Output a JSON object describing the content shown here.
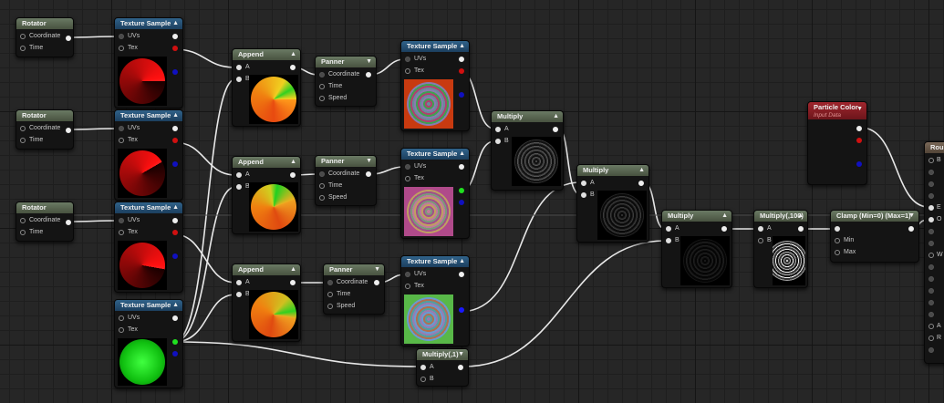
{
  "nodes": {
    "rotator1": {
      "title": "Rotator",
      "pins": [
        "Coordinate",
        "Time"
      ]
    },
    "rotator2": {
      "title": "Rotator",
      "pins": [
        "Coordinate",
        "Time"
      ]
    },
    "rotator3": {
      "title": "Rotator",
      "pins": [
        "Coordinate",
        "Time"
      ]
    },
    "texsample1": {
      "title": "Texture Sample",
      "pins": [
        "UVs",
        "Tex"
      ]
    },
    "texsample2": {
      "title": "Texture Sample",
      "pins": [
        "UVs",
        "Tex"
      ]
    },
    "texsample3": {
      "title": "Texture Sample",
      "pins": [
        "UVs",
        "Tex"
      ]
    },
    "texsample4": {
      "title": "Texture Sample",
      "pins": [
        "UVs",
        "Tex"
      ]
    },
    "append1": {
      "title": "Append",
      "pins": [
        "A",
        "B"
      ]
    },
    "append2": {
      "title": "Append",
      "pins": [
        "A",
        "B"
      ]
    },
    "append3": {
      "title": "Append",
      "pins": [
        "A",
        "B"
      ]
    },
    "panner1": {
      "title": "Panner",
      "pins": [
        "Coordinate",
        "Time",
        "Speed"
      ]
    },
    "panner2": {
      "title": "Panner",
      "pins": [
        "Coordinate",
        "Time",
        "Speed"
      ]
    },
    "panner3": {
      "title": "Panner",
      "pins": [
        "Coordinate",
        "Time",
        "Speed"
      ]
    },
    "texsample5": {
      "title": "Texture Sample",
      "pins": [
        "UVs",
        "Tex"
      ]
    },
    "texsample6": {
      "title": "Texture Sample",
      "pins": [
        "UVs",
        "Tex"
      ]
    },
    "texsample7": {
      "title": "Texture Sample",
      "pins": [
        "UVs",
        "Tex"
      ]
    },
    "multiply1": {
      "title": "Multiply",
      "pins": [
        "A",
        "B"
      ]
    },
    "multiply2": {
      "title": "Multiply",
      "pins": [
        "A",
        "B"
      ]
    },
    "multiply3": {
      "title": "Multiply",
      "pins": [
        "A",
        "B"
      ]
    },
    "multiply_one": {
      "title": "Multiply(,1)",
      "pins": [
        "A",
        "B"
      ]
    },
    "multiply_hundred": {
      "title": "Multiply(,100)",
      "pins": [
        "A",
        "B"
      ]
    },
    "clamp": {
      "title": "Clamp (Min=0) (Max=1)",
      "pins": [
        "Min",
        "Max"
      ]
    },
    "particlecolor": {
      "title": "Particle Color",
      "subtitle": "Input Data"
    },
    "result": {
      "title": "Roun"
    }
  },
  "colors": {
    "wire": "#e8e8e8",
    "header_green": "#5d6b57",
    "header_blue": "#24506f",
    "header_red": "#8e1c24",
    "red_channel": "#d01010",
    "green_channel": "#20c020",
    "blue_channel": "#1010c0"
  },
  "icons": {
    "collapse": "chevron-down-icon",
    "result_pins": [
      "B",
      "E",
      "O",
      "W",
      "A",
      "R"
    ]
  }
}
